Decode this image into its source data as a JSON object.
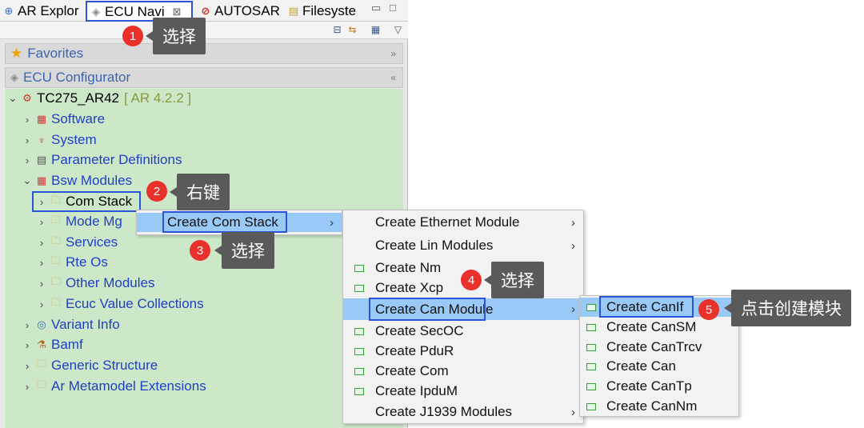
{
  "tabs": [
    {
      "label": "AR Explor",
      "icon": "explorer-icon"
    },
    {
      "label": "ECU Navi",
      "icon": "ecu-navigator-icon",
      "close": "⊠"
    },
    {
      "label": "AUTOSAR",
      "icon": "autosar-icon"
    },
    {
      "label": "Filesyste",
      "icon": "filesystem-icon"
    }
  ],
  "sections": {
    "favorites": "Favorites",
    "ecu_configurator": "ECU Configurator"
  },
  "tree": {
    "root_label": "TC275_AR42",
    "root_version": "[ AR 4.2.2 ]",
    "software": "Software",
    "system": "System",
    "parameter_definitions": "Parameter Definitions",
    "bsw_modules": "Bsw Modules",
    "com_stack": "Com Stack",
    "mode_mgmt": "Mode Mg",
    "services": "Services",
    "rte_os": "Rte Os",
    "other_modules": "Other Modules",
    "ecuc_value_collections": "Ecuc Value Collections",
    "variant_info": "Variant Info",
    "bamf": "Bamf",
    "generic_structure": "Generic Structure",
    "ar_metamodel_extensions": "Ar Metamodel Extensions"
  },
  "menu1": {
    "create_com_stack": "Create Com Stack"
  },
  "menu2": {
    "create_ethernet_module": "Create Ethernet Module",
    "create_lin_modules": "Create Lin Modules",
    "create_nm": "Create Nm",
    "create_xcp": "Create Xcp",
    "create_can_module": "Create Can Module",
    "create_secoc": "Create SecOC",
    "create_pdur": "Create PduR",
    "create_com": "Create Com",
    "create_ipdum": "Create IpduM",
    "create_j1939_modules": "Create J1939 Modules"
  },
  "menu3": {
    "create_canif": "Create CanIf",
    "create_cansm": "Create CanSM",
    "create_cantrcv": "Create CanTrcv",
    "create_can": "Create Can",
    "create_cantp": "Create CanTp",
    "create_cannm": "Create CanNm"
  },
  "annotations": [
    {
      "number": "1",
      "text": "选择"
    },
    {
      "number": "2",
      "text": "右键"
    },
    {
      "number": "3",
      "text": "选择"
    },
    {
      "number": "4",
      "text": "选择"
    },
    {
      "number": "5",
      "text": "点击创建模块"
    }
  ],
  "colors": {
    "highlight_box": "#2b55d8",
    "tree_background": "#cde8c9",
    "menu_hover": "#99c9f6",
    "badge": "#e9302a",
    "callout": "#5a5a5a"
  }
}
